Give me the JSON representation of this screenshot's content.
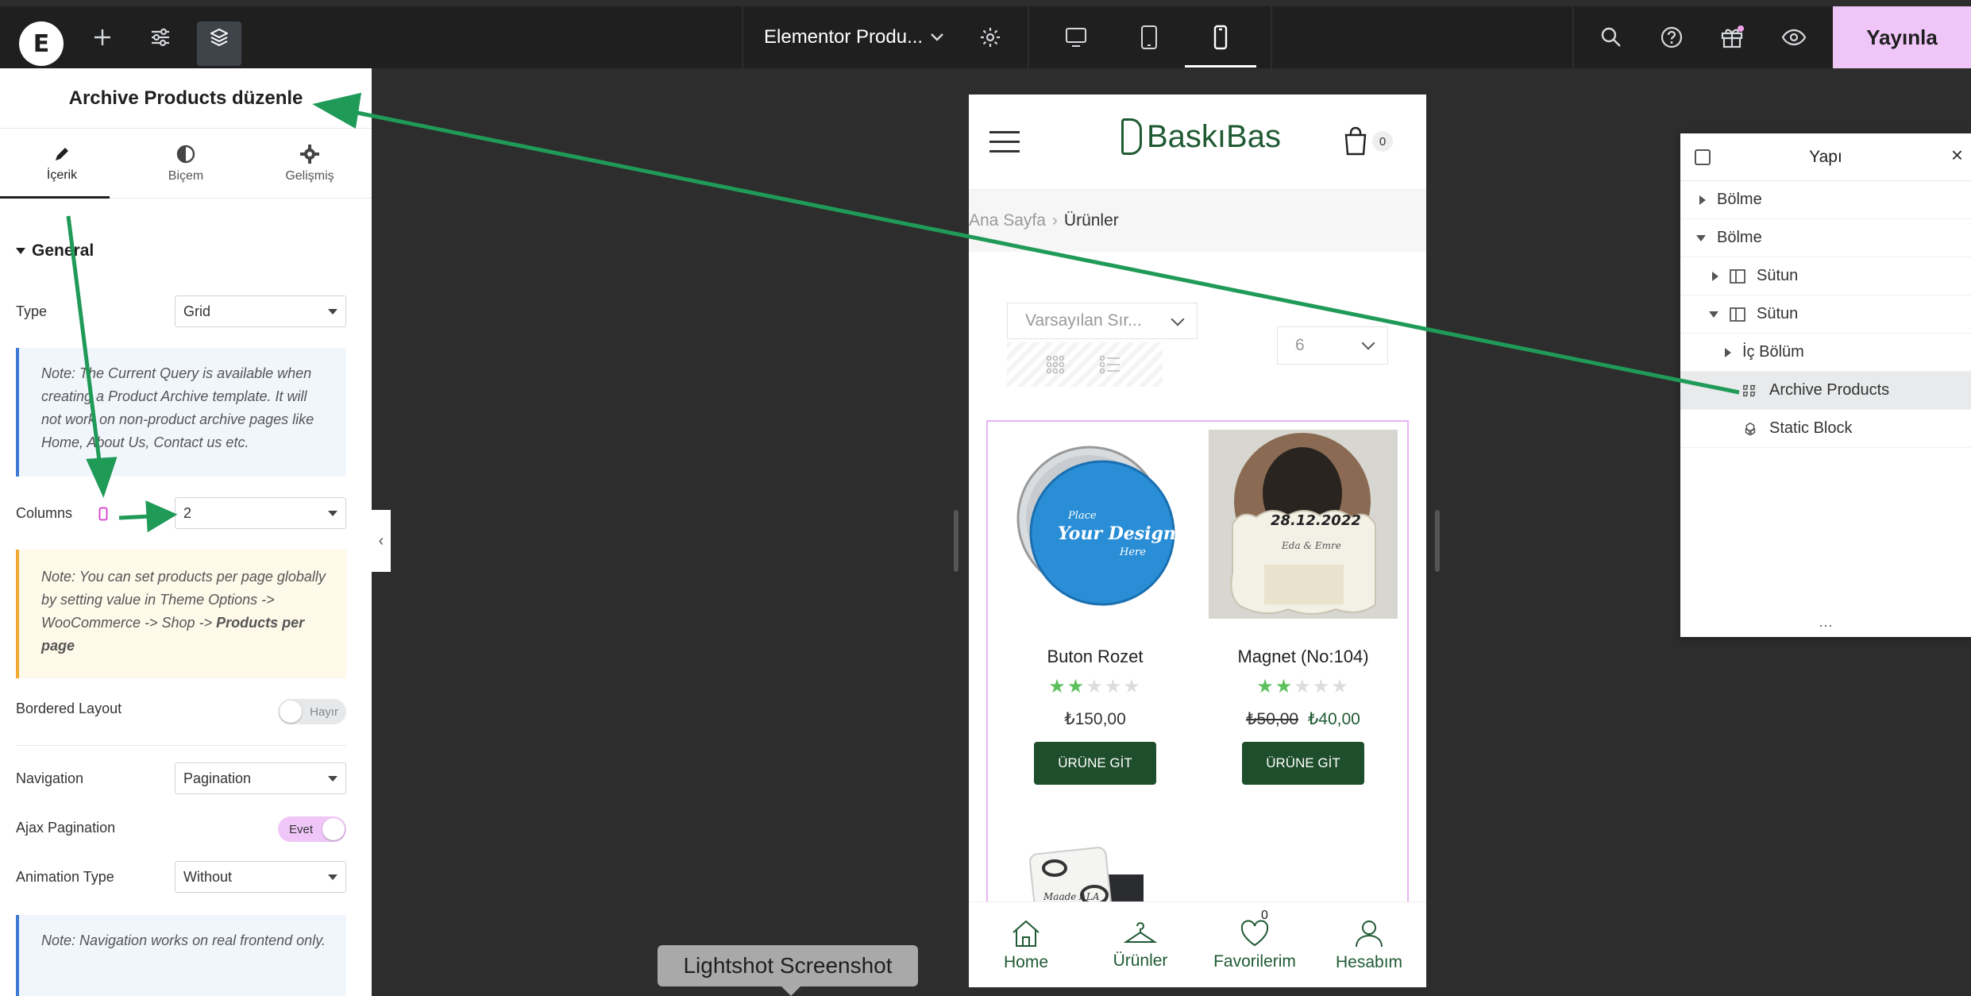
{
  "topbar": {
    "document_title": "Elementor Produ...",
    "publish_label": "Yayınla",
    "colors": {
      "bar": "#1f1f1f",
      "publish": "#f0c6f8"
    }
  },
  "panel": {
    "title": "Archive Products düzenle",
    "tabs": [
      {
        "label": "İçerik",
        "icon": "pencil-icon"
      },
      {
        "label": "Biçem",
        "icon": "contrast-icon"
      },
      {
        "label": "Gelişmiş",
        "icon": "gear-icon"
      }
    ],
    "section_title": "General",
    "type": {
      "label": "Type",
      "value": "Grid"
    },
    "query_note": "Note: The Current Query is available when creating a Product Archive template. It will not work on non-product archive pages like Home, About Us, Contact us etc.",
    "columns": {
      "label": "Columns",
      "value": "2"
    },
    "per_page_note_prefix": "Note: You can set products per page globally by setting value in Theme Options -> WooCommerce -> Shop -> ",
    "per_page_note_bold": "Products per page",
    "bordered_layout": {
      "label": "Bordered Layout",
      "state": "Hayır"
    },
    "navigation": {
      "label": "Navigation",
      "value": "Pagination"
    },
    "ajax_pagination": {
      "label": "Ajax Pagination",
      "state": "Evet"
    },
    "animation_type": {
      "label": "Animation Type",
      "value": "Without"
    },
    "navigation_note": "Note: Navigation works on real frontend only."
  },
  "preview": {
    "brand": "BaskıBas",
    "cart_count": "0",
    "breadcrumb_home": "Ana Sayfa",
    "breadcrumb_current": "Ürünler",
    "sort_value": "Varsayılan Sır...",
    "per_page_value": "6",
    "products": [
      {
        "name": "Buton Rozet",
        "rating": 2,
        "price": "₺150,00",
        "old_price": "",
        "cta": "ÜRÜNE GİT"
      },
      {
        "name": "Magnet (No:104)",
        "rating": 2,
        "price": "₺40,00",
        "old_price": "₺50,00",
        "cta": "ÜRÜNE GİT"
      }
    ],
    "rozet_text": {
      "line1": "Place",
      "line2": "Your Design",
      "line3": "Here"
    },
    "magnet_text": {
      "date": "28.12.2022",
      "names": "Eda & Emre"
    },
    "third_product_text": "Maade ALA",
    "bottom_nav": [
      {
        "label": "Home",
        "icon": "home-icon"
      },
      {
        "label": "Ürünler",
        "icon": "hanger-icon"
      },
      {
        "label": "Favorilerim",
        "icon": "heart-icon",
        "count": "0"
      },
      {
        "label": "Hesabım",
        "icon": "user-icon"
      }
    ],
    "colors": {
      "brand_green": "#1f5a33",
      "button_green": "#1e4e2b",
      "star": "#5ec05e",
      "widget_outline": "#e6b4f4"
    }
  },
  "navigator": {
    "title": "Yapı",
    "items": [
      {
        "label": "Bölme",
        "depth": 0,
        "expanded": false
      },
      {
        "label": "Bölme",
        "depth": 0,
        "expanded": true
      },
      {
        "label": "Sütun",
        "depth": 1,
        "expanded": false
      },
      {
        "label": "Sütun",
        "depth": 1,
        "expanded": true
      },
      {
        "label": "İç Bölüm",
        "depth": 2,
        "expanded": false
      },
      {
        "label": "Archive Products",
        "depth": 2,
        "selected": true
      },
      {
        "label": "Static Block",
        "depth": 2
      }
    ]
  },
  "tooltip": "Lightshot Screenshot",
  "annotation_color": "#1f9a57"
}
